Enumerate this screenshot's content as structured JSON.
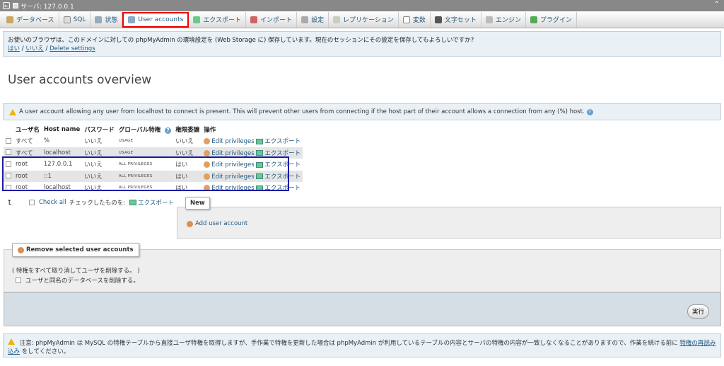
{
  "titlebar": {
    "title": "サーバ: 127.0.0.1"
  },
  "tabs": [
    {
      "label": "データベース"
    },
    {
      "label": "SQL"
    },
    {
      "label": "状態"
    },
    {
      "label": "User accounts"
    },
    {
      "label": "エクスポート"
    },
    {
      "label": "インポート"
    },
    {
      "label": "設定"
    },
    {
      "label": "レプリケーション"
    },
    {
      "label": "変数"
    },
    {
      "label": "文字セット"
    },
    {
      "label": "エンジン"
    },
    {
      "label": "プラグイン"
    }
  ],
  "notice": {
    "text": "お使いのブラウザは、このドメインに対しての phpMyAdmin の環境設定を (Web Storage に) 保存しています。現在のセッションにその設定を保存してもよろしいですか?",
    "yes": "はい",
    "no": "いいえ",
    "delete": "Delete settings",
    "sep": "/"
  },
  "page_title": "User accounts overview",
  "warning": "A user account allowing any user from localhost to connect is present. This will prevent other users from connecting if the host part of their account allows a connection from any (%) host.",
  "table": {
    "headers": [
      "ユーザ名",
      "Host name",
      "パスワード",
      "グローバル特権",
      "権限委譲",
      "操作"
    ],
    "rows": [
      {
        "user": "すべて",
        "host": "%",
        "password": "いいえ",
        "privs": "USAGE",
        "grant": "いいえ",
        "edit": "Edit privileges",
        "export": "エクスポート"
      },
      {
        "user": "すべて",
        "host": "localhost",
        "password": "いいえ",
        "privs": "USAGE",
        "grant": "いいえ",
        "edit": "Edit privileges",
        "export": "エクスポート"
      },
      {
        "user": "root",
        "host": "127.0.0.1",
        "password": "いいえ",
        "privs": "ALL PRIVILEGES",
        "grant": "はい",
        "edit": "Edit privileges",
        "export": "エクスポート"
      },
      {
        "user": "root",
        "host": "::1",
        "password": "いいえ",
        "privs": "ALL PRIVILEGES",
        "grant": "はい",
        "edit": "Edit privileges",
        "export": "エクスポート"
      },
      {
        "user": "root",
        "host": "localhost",
        "password": "いいえ",
        "privs": "ALL PRIVILEGES",
        "grant": "はい",
        "edit": "Edit privileges",
        "export": "エクスポート"
      }
    ]
  },
  "checkall": {
    "label": "Check all",
    "with_selected": "チェックしたものを:",
    "export": "エクスポート"
  },
  "new_panel": {
    "legend": "New",
    "add_user": "Add user account"
  },
  "remove_panel": {
    "legend": "Remove selected user accounts",
    "text": "( 特権をすべて取り消してユーザを削除する。 )",
    "checkbox_label": "ユーザと同名のデータベースを削除する。",
    "exec": "実行"
  },
  "notice2": {
    "text": "注意: phpMyAdmin は MySQL の特権テーブルから直接ユーザ特権を取得しますが、手作業で特権を更新した場合は phpMyAdmin が利用しているテーブルの内容とサーバの特権の内容が一致しなくなることがありますので、作業を続ける前に",
    "link": "特権の再読み込み",
    "tail": "をしてください。"
  }
}
